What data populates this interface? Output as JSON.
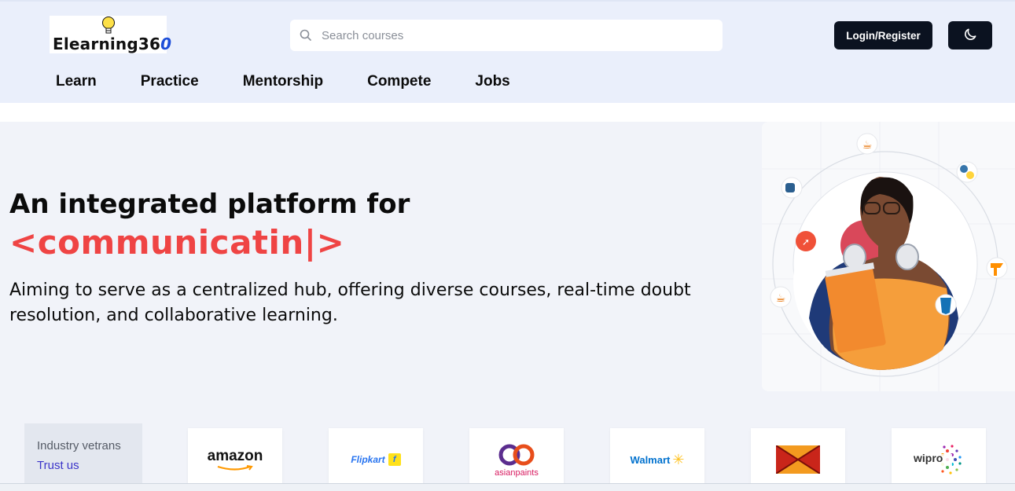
{
  "brand": {
    "name": "Elearning36",
    "accent": "0"
  },
  "search": {
    "placeholder": "Search courses"
  },
  "actions": {
    "login_label": "Login/Register"
  },
  "nav": [
    "Learn",
    "Practice",
    "Mentorship",
    "Compete",
    "Jobs"
  ],
  "hero": {
    "title": "An integrated platform for",
    "typed": "<communicatin|>",
    "description": "Aiming to serve as a centralized hub, offering diverse courses, real-time doubt resolution, and collaborative learning."
  },
  "trust": {
    "line1": "Industry vetrans",
    "line2": "Trust us"
  },
  "companies": [
    {
      "name": "amazon",
      "icon": "amazon-logo"
    },
    {
      "name": "Flipkart",
      "icon": "flipkart-logo"
    },
    {
      "name": "asianpaints",
      "icon": "asianpaints-logo"
    },
    {
      "name": "Walmart",
      "icon": "walmart-logo"
    },
    {
      "name": "",
      "icon": "mx-logo"
    },
    {
      "name": "wipro",
      "icon": "wipro-logo"
    }
  ],
  "colors": {
    "header_bg": "#eaeffb",
    "accent_red": "#ef4444",
    "dark_button": "#0b1220",
    "trust_link": "#3b34c9"
  }
}
